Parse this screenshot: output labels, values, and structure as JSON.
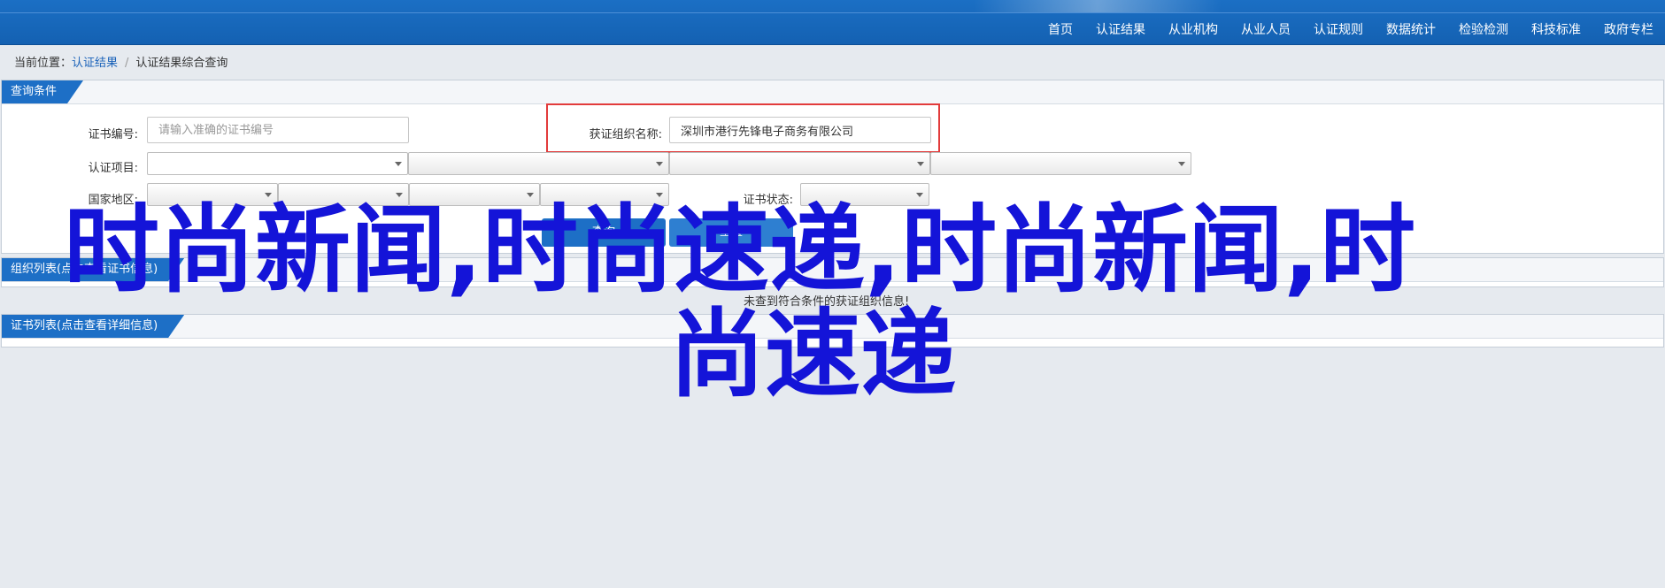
{
  "nav": {
    "items": [
      "首页",
      "认证结果",
      "从业机构",
      "从业人员",
      "认证规则",
      "数据统计",
      "检验检测",
      "科技标准",
      "政府专栏"
    ]
  },
  "breadcrumb": {
    "prefix": "当前位置：",
    "items": [
      "认证结果",
      "认证结果综合查询"
    ]
  },
  "query_panel": {
    "title": "查询条件",
    "cert_no_label": "证书编号:",
    "cert_no_placeholder": "请输入准确的证书编号",
    "org_label": "获证组织名称:",
    "org_value": "深圳市港行先锋电子商务有限公司",
    "project_label": "认证项目:",
    "region_label": "国家地区:",
    "status_label": "证书状态:",
    "query_button": "查询",
    "reset_button": "重置"
  },
  "org_panel": {
    "title": "组织列表(点击查看证书信息)",
    "empty_text": "未查到符合条件的获证组织信息!"
  },
  "cert_panel": {
    "title": "证书列表(点击查看详细信息)"
  },
  "overlay": {
    "line1": "时尚新闻,时尚速递,时尚新闻,时",
    "line2": "尚速递"
  },
  "colors": {
    "nav_bg": "#1461b2",
    "tab_bg": "#1d6fc6",
    "highlight_border": "#e23b3b",
    "overlay_text": "#1414d8",
    "page_bg": "#e6eaef"
  }
}
